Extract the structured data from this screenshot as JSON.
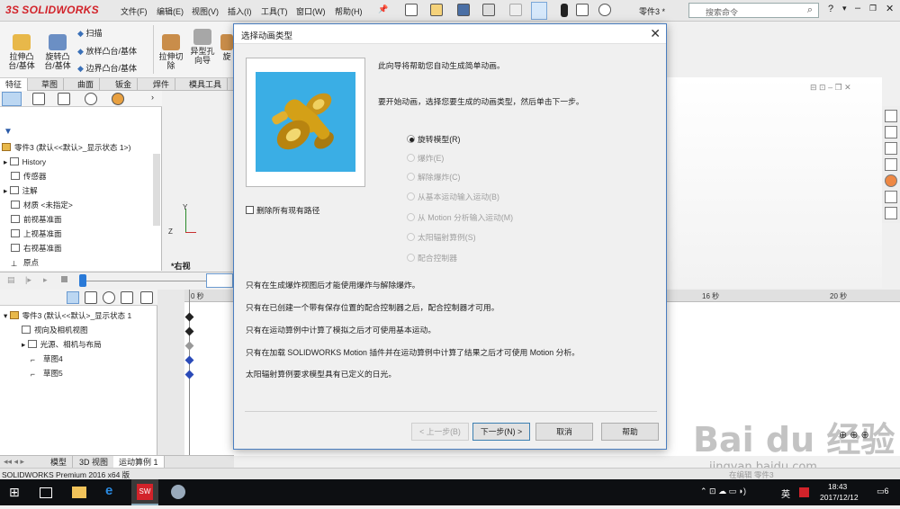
{
  "app": {
    "logo_text": "SOLIDWORKS",
    "menus": [
      "文件(F)",
      "编辑(E)",
      "视图(V)",
      "插入(I)",
      "工具(T)",
      "窗口(W)",
      "帮助(H)"
    ],
    "doc_name": "零件3 *",
    "search_placeholder": "搜索命令",
    "brand_color": "#d2232a"
  },
  "ribbon": {
    "items": [
      {
        "label_1": "拉伸凸",
        "label_2": "台/基体"
      },
      {
        "label_1": "旋转凸",
        "label_2": "台/基体"
      },
      {
        "label_1": "拉伸切",
        "label_2": "除"
      },
      {
        "label_1": "异型孔",
        "label_2": "向导"
      },
      {
        "label_1": "旋",
        "label_2": ""
      }
    ],
    "small_items": [
      "扫描",
      "放样凸台/基体",
      "边界凸台/基体"
    ],
    "tabs": [
      "特征",
      "草图",
      "曲面",
      "钣金",
      "焊件",
      "模具工具"
    ]
  },
  "tree": {
    "root": "零件3 (默认<<默认>_显示状态 1>)",
    "items": [
      "History",
      "传感器",
      "注解",
      "材质 <未指定>",
      "前视基准面",
      "上视基准面",
      "右视基准面",
      "原点"
    ]
  },
  "view": {
    "label": "*右视",
    "axis_y": "Y",
    "axis_z": "Z"
  },
  "motion": {
    "root": "零件3 (默认<<默认>_显示状态 1",
    "items": [
      "视向及相机视图",
      "光源、相机与布局",
      "草图4",
      "草图5"
    ],
    "ruler_labels": [
      "0 秒",
      "16 秒",
      "20 秒"
    ],
    "bottom_tabs": [
      "模型",
      "3D 视图",
      "运动算例 1"
    ]
  },
  "statusbar": {
    "left": "SOLIDWORKS Premium 2016 x64 版",
    "right_partial": "在编辑 零件3"
  },
  "taskbar": {
    "time": "18:43",
    "date": "2017/12/12",
    "ime": "英",
    "notif_count": "6"
  },
  "dialog": {
    "title": "选择动画类型",
    "intro": "此向导将帮助您自动生成简单动画。",
    "instruction": "要开始动画，选择您要生成的动画类型，然后单击下一步。",
    "options": [
      {
        "label": "旋转模型(R)",
        "selected": true,
        "enabled": true
      },
      {
        "label": "爆炸(E)",
        "selected": false,
        "enabled": false
      },
      {
        "label": "解除爆炸(C)",
        "selected": false,
        "enabled": false
      },
      {
        "label": "从基本运动输入运动(B)",
        "selected": false,
        "enabled": false
      },
      {
        "label": "从 Motion 分析输入运动(M)",
        "selected": false,
        "enabled": false
      },
      {
        "label": "太阳辐射算例(S)",
        "selected": false,
        "enabled": false
      },
      {
        "label": "配合控制器",
        "selected": false,
        "enabled": false
      }
    ],
    "delete_paths": "删除所有现有路径",
    "notes": [
      "只有在生成爆炸视图后才能使用爆炸与解除爆炸。",
      "只有在已创建一个带有保存位置的配合控制器之后，配合控制器才可用。",
      "只有在运动算例中计算了模拟之后才可使用基本运动。",
      "只有在加载 SOLIDWORKS Motion 插件并在运动算例中计算了结果之后才可使用 Motion 分析。",
      "太阳辐射算例要求模型具有已定义的日光。"
    ],
    "buttons": {
      "back": "< 上一步(B)",
      "next": "下一步(N) >",
      "cancel": "取消",
      "help": "帮助"
    },
    "preview_bg": "#3aaee5",
    "part_color": "#d4a017"
  },
  "watermark": {
    "main": "Bai du 经验",
    "sub": "jingyan.baidu.com"
  }
}
